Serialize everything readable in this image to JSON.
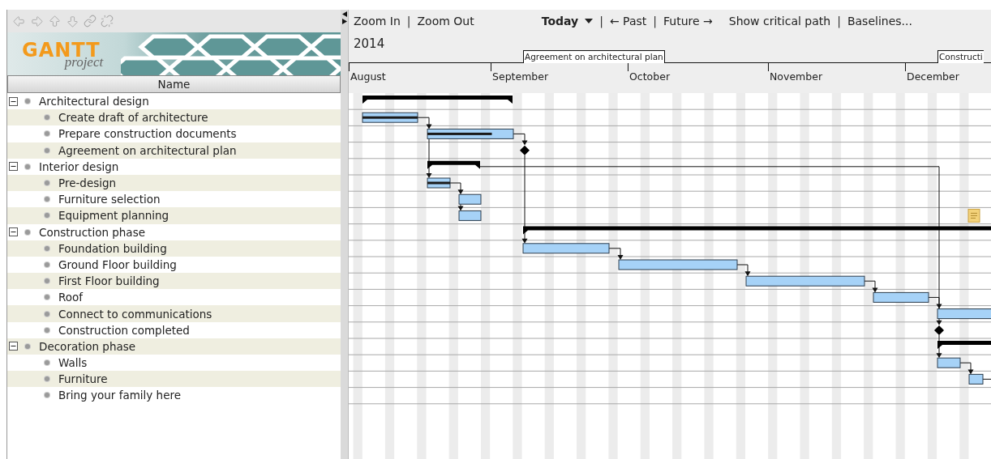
{
  "logo": {
    "word": "GANTT",
    "tagline": "project"
  },
  "tree": {
    "column": "Name",
    "tasks": [
      {
        "name": "Architectural design",
        "kind": "summary",
        "expanded": true,
        "children": [
          {
            "name": "Create draft of architecture",
            "kind": "task",
            "level": 1,
            "has_note": false
          },
          {
            "name": "Prepare construction documents",
            "kind": "task",
            "level": 0.75,
            "has_note": false
          },
          {
            "name": "Agreement on architectural plan",
            "kind": "milestone"
          }
        ]
      },
      {
        "name": "Interior design",
        "kind": "summary",
        "expanded": true,
        "children": [
          {
            "name": "Pre-design",
            "kind": "task",
            "level": 1,
            "has_note": false
          },
          {
            "name": "Furniture selection",
            "kind": "task",
            "has_note": false
          },
          {
            "name": "Equipment planning",
            "kind": "task",
            "has_note": true
          }
        ]
      },
      {
        "name": "Construction phase",
        "kind": "summary",
        "expanded": true,
        "children": [
          {
            "name": "Foundation building",
            "kind": "task",
            "has_note": false
          },
          {
            "name": "Ground Floor building",
            "kind": "task",
            "has_note": false
          },
          {
            "name": "First Floor building",
            "kind": "task",
            "has_note": false
          },
          {
            "name": "Roof",
            "kind": "task",
            "has_note": false
          },
          {
            "name": "Connect to communications",
            "kind": "task",
            "has_note": false
          },
          {
            "name": "Construction completed",
            "kind": "milestone"
          }
        ]
      },
      {
        "name": "Decoration phase",
        "kind": "summary",
        "expanded": true,
        "children": [
          {
            "name": "Walls",
            "kind": "task",
            "has_note": false
          },
          {
            "name": "Furniture",
            "kind": "task",
            "has_note": false
          },
          {
            "name": "Bring your family here",
            "kind": "task",
            "has_note": false
          }
        ]
      }
    ]
  },
  "chart_toolbar": {
    "groups": [
      [
        {
          "kind": "link",
          "text": "Zoom In"
        },
        {
          "kind": "separator",
          "text": "|"
        },
        {
          "kind": "link",
          "text": "Zoom Out"
        }
      ],
      [
        {
          "kind": "dropdown",
          "text": "Today"
        },
        {
          "kind": "separator",
          "text": "|"
        },
        {
          "kind": "link",
          "text": "← Past"
        },
        {
          "kind": "separator",
          "text": "|"
        },
        {
          "kind": "link",
          "text": "Future →"
        }
      ],
      [
        {
          "kind": "link",
          "text": "Show critical path"
        },
        {
          "kind": "separator",
          "text": "|"
        },
        {
          "kind": "link",
          "text": "Baselines..."
        }
      ]
    ]
  },
  "timeline": {
    "year": "2014",
    "months": [
      "August",
      "September",
      "October",
      "November",
      "December"
    ],
    "flags": [
      "Agreement on architectural plan",
      "Constructi"
    ]
  }
}
